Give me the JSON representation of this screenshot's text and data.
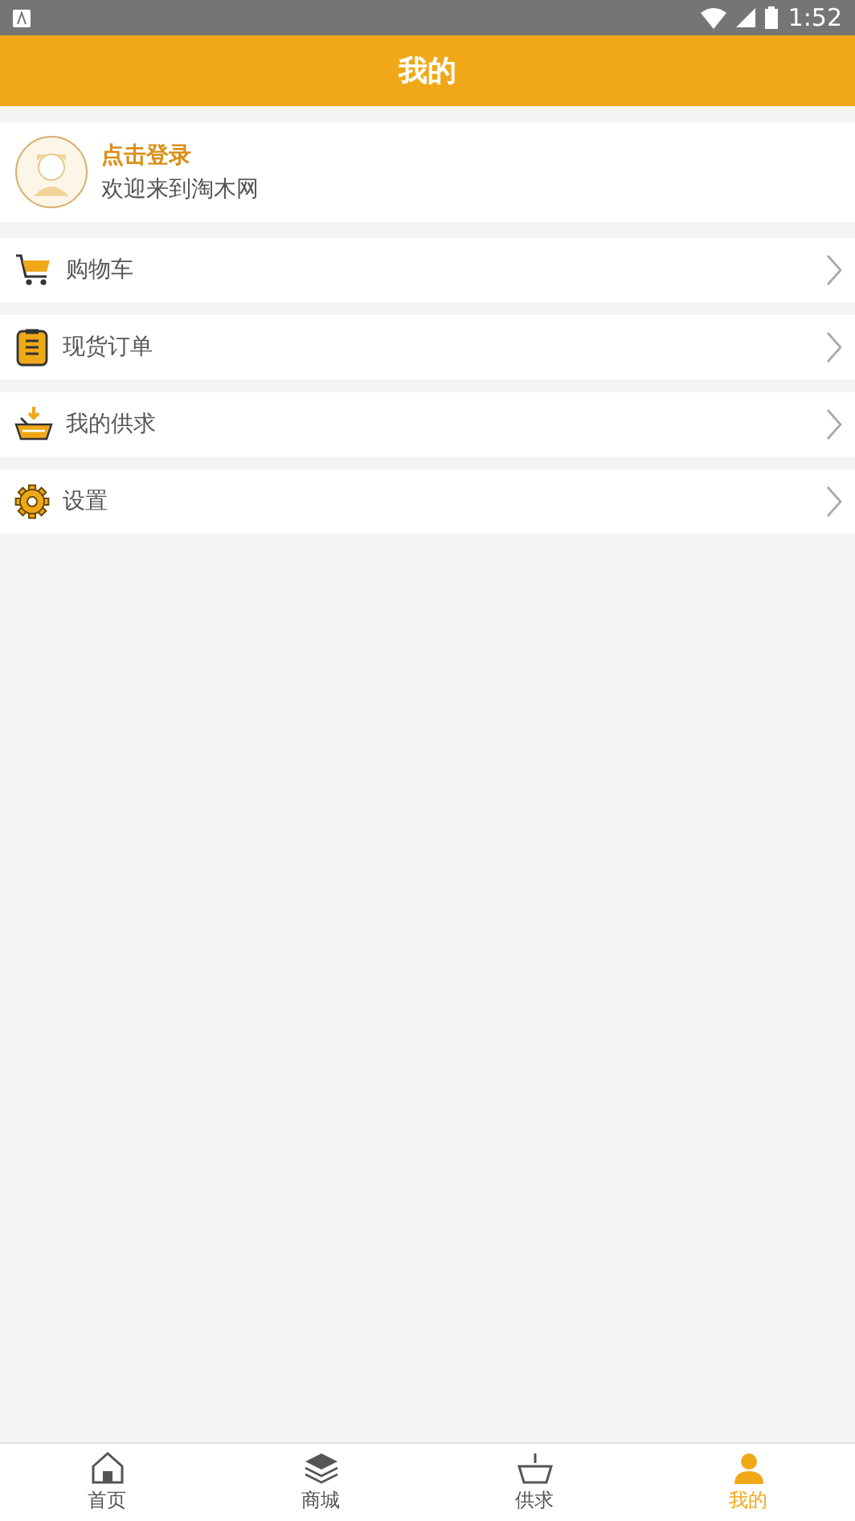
{
  "status_bar": {
    "time": "1:52"
  },
  "header": {
    "title": "我的"
  },
  "profile": {
    "title": "点击登录",
    "subtitle": "欢迎来到淘木网"
  },
  "menu": [
    {
      "kind": "cart",
      "label": "购物车"
    },
    {
      "kind": "order",
      "label": "现货订单"
    },
    {
      "kind": "supply",
      "label": "我的供求"
    },
    {
      "kind": "settings",
      "label": "设置"
    }
  ],
  "tabs": [
    {
      "kind": "home",
      "label": "首页",
      "selected": false
    },
    {
      "kind": "mall",
      "label": "商城",
      "selected": false
    },
    {
      "kind": "supply",
      "label": "供求",
      "selected": false
    },
    {
      "kind": "me",
      "label": "我的",
      "selected": true
    }
  ]
}
